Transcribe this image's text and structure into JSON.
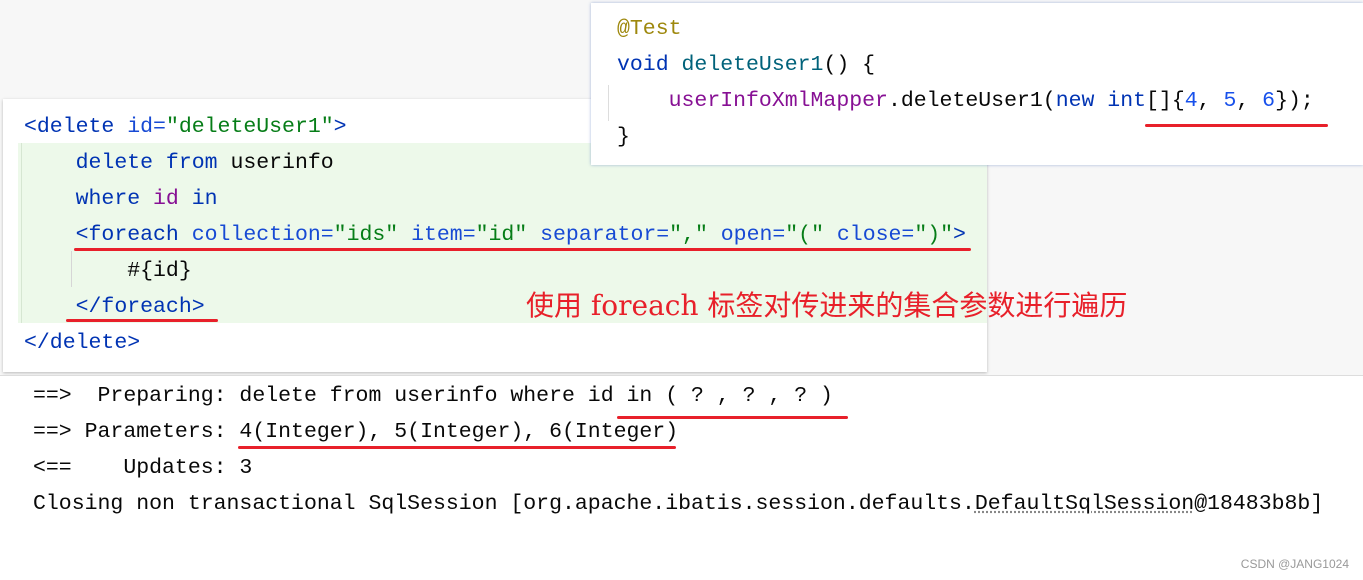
{
  "xml_code": [
    [
      [
        "<delete ",
        "t"
      ],
      [
        "id=",
        "a"
      ],
      [
        "\"deleteUser1\"",
        "s"
      ],
      [
        ">",
        "t"
      ]
    ],
    [
      [
        "    ",
        "d"
      ],
      [
        "delete from ",
        "k"
      ],
      [
        "userinfo",
        "d"
      ]
    ],
    [
      [
        "    ",
        "d"
      ],
      [
        "where ",
        "k"
      ],
      [
        "id ",
        "p"
      ],
      [
        "in",
        "k"
      ]
    ],
    [
      [
        "    ",
        "d"
      ],
      [
        "<foreach ",
        "t"
      ],
      [
        "collection=",
        "a"
      ],
      [
        "\"ids\" ",
        "s"
      ],
      [
        "item=",
        "a"
      ],
      [
        "\"id\" ",
        "s"
      ],
      [
        "separator=",
        "a"
      ],
      [
        "\",\" ",
        "s"
      ],
      [
        "open=",
        "a"
      ],
      [
        "\"(\" ",
        "s"
      ],
      [
        "close=",
        "a"
      ],
      [
        "\")\"",
        "s"
      ],
      [
        ">",
        "t"
      ]
    ],
    [
      [
        "        #{id}",
        "d"
      ]
    ],
    [
      [
        "    ",
        "d"
      ],
      [
        "</foreach>",
        "t"
      ]
    ],
    [
      [
        "</delete>",
        "t"
      ]
    ]
  ],
  "test_code": [
    [
      [
        "@Test",
        "an"
      ]
    ],
    [
      [
        "void ",
        "k"
      ],
      [
        "deleteUser1",
        "f"
      ],
      [
        "() {",
        "d"
      ]
    ],
    [
      [
        "    ",
        "d"
      ],
      [
        "userInfoXmlMapper",
        "id"
      ],
      [
        ".deleteUser1(",
        "d"
      ],
      [
        "new ",
        "k"
      ],
      [
        "int",
        "k"
      ],
      [
        "[]{",
        "d"
      ],
      [
        "4",
        "n"
      ],
      [
        ", ",
        "d"
      ],
      [
        "5",
        "n"
      ],
      [
        ", ",
        "d"
      ],
      [
        "6",
        "n"
      ],
      [
        "});",
        "d"
      ]
    ],
    [
      [
        "}",
        "d"
      ]
    ]
  ],
  "console": [
    "==>  Preparing: delete from userinfo where id in ( ? , ? , ? )",
    "==> Parameters: 4(Integer), 5(Integer), 6(Integer)",
    "<==    Updates: 3"
  ],
  "console_last": {
    "prefix": "Closing non transactional SqlSession [org.apache.ibatis.session.defaults.",
    "link": "DefaultSqlSession",
    "suffix": "@18483b8b]"
  },
  "annotation": "使用 foreach 标签对传进来的集合参数进行遍历",
  "watermark": "CSDN @JANG1024",
  "colors": {
    "underline": "#e8202a",
    "tag": "#0033b3",
    "string": "#067d17",
    "highlight_bg": "#edf9ea"
  }
}
